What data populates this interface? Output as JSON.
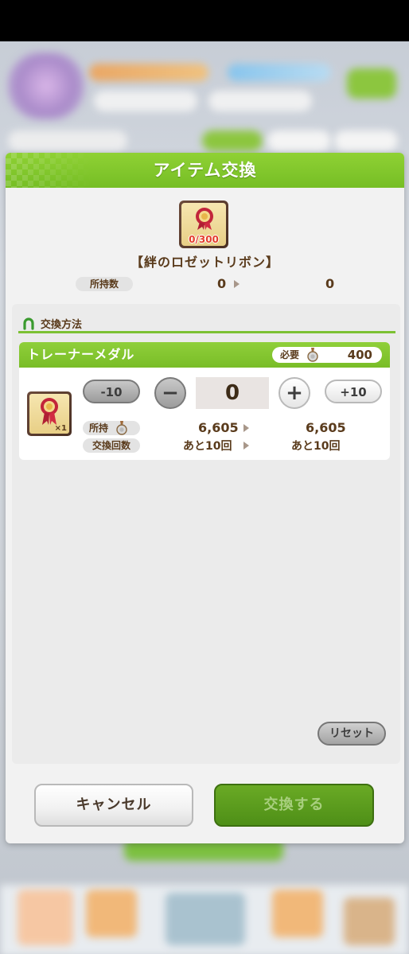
{
  "modal": {
    "title": "アイテム交換",
    "item": {
      "count": "0/300",
      "name": "【絆のロゼットリボン】",
      "owned_label": "所持数",
      "owned_before": "0",
      "owned_after": "0"
    },
    "section": {
      "title": "交換方法"
    },
    "card": {
      "title": "トレーナーメダル",
      "need_label": "必要",
      "need_value": "400",
      "material_qty": "×1",
      "minus10_label": "-10",
      "minus_label": "−",
      "quantity": "0",
      "plus_label": "+",
      "plus10_label": "+10",
      "owned_label": "所持",
      "owned_before": "6,605",
      "owned_after": "6,605",
      "count_label": "交換回数",
      "count_before": "あと10回",
      "count_after": "あと10回"
    },
    "reset_label": "リセット",
    "cancel_label": "キャンセル",
    "exchange_label": "交換する"
  }
}
